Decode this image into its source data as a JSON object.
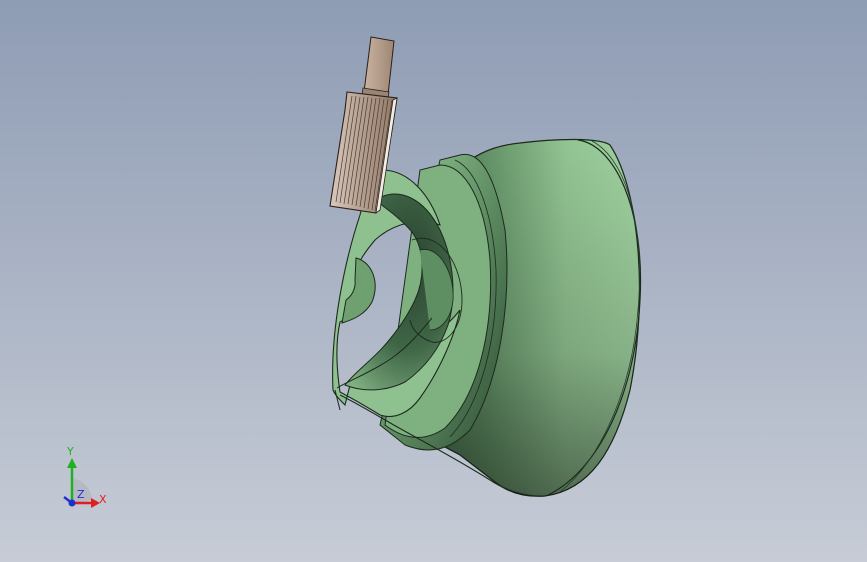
{
  "viewport": {
    "background_top": "#8e9cb4",
    "background_bottom": "#c7ccd6"
  },
  "model": {
    "part_color": "#93c493",
    "part_shadow": "#2e4a32",
    "gear_color": "#b8a596",
    "shaft_color": "#b9a290"
  },
  "triad": {
    "x_label": "X",
    "y_label": "Y",
    "z_label": "Z",
    "x_color": "#e02020",
    "y_color": "#20b020",
    "z_color": "#2030d0"
  }
}
